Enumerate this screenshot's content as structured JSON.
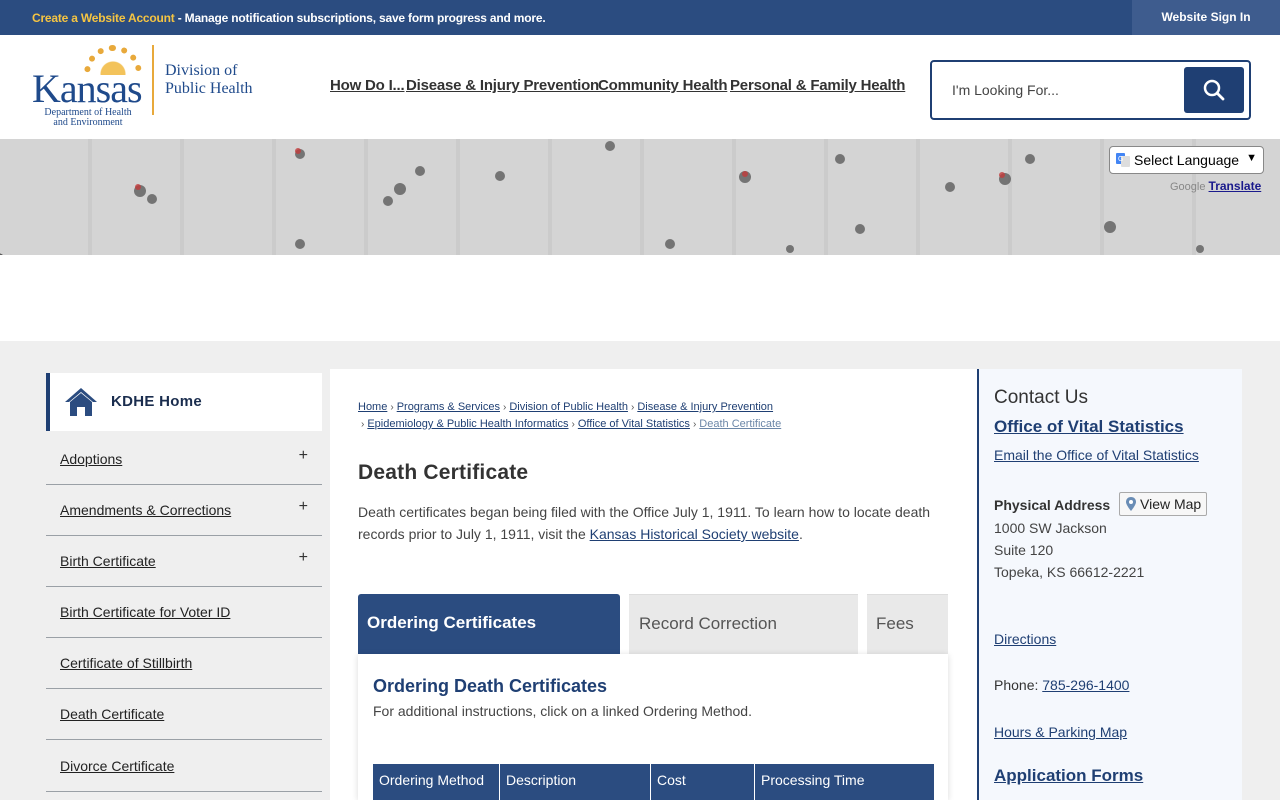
{
  "topbar": {
    "promo_link": "Create a Website Account",
    "promo_text": " - Manage notification subscriptions, save form progress and more.",
    "sign_in": "Website Sign In"
  },
  "logo": {
    "brand": "Kansas",
    "dept_line1": "Department of Health",
    "dept_line2": "and Environment",
    "division_line1": "Division of",
    "division_line2": "Public Health"
  },
  "nav": {
    "items": [
      "How Do I...",
      "Disease & Injury Prevention",
      "Community Health",
      "Personal & Family Health"
    ]
  },
  "search": {
    "placeholder": "I'm Looking For..."
  },
  "translate": {
    "select_label": "Select Language",
    "powered_by": "Google",
    "translate_label": "Translate"
  },
  "sidebar": {
    "home_label": "KDHE Home",
    "items": [
      {
        "label": "Adoptions",
        "expand": "+"
      },
      {
        "label": "Amendments & Corrections",
        "expand": "+"
      },
      {
        "label": "Birth Certificate",
        "expand": "+"
      },
      {
        "label": "Birth Certificate for Voter ID",
        "expand": ""
      },
      {
        "label": "Certificate of Stillbirth",
        "expand": ""
      },
      {
        "label": "Death Certificate",
        "expand": ""
      },
      {
        "label": "Divorce Certificate",
        "expand": ""
      }
    ]
  },
  "breadcrumb": {
    "items": [
      "Home",
      "Programs & Services",
      "Division of Public Health",
      "Disease & Injury Prevention",
      "Epidemiology & Public Health Informatics",
      "Office of Vital Statistics"
    ],
    "current": "Death Certificate"
  },
  "page": {
    "title": "Death Certificate",
    "intro_text": "Death certificates began being filed with the Office July 1, 1911. To learn how to locate death records prior to July 1, 1911, visit the ",
    "intro_link": "Kansas Historical Society website",
    "intro_end": "."
  },
  "tabs": [
    "Ordering Certificates",
    "Record Correction",
    "Fees"
  ],
  "panel": {
    "heading": "Ordering Death Certificates",
    "subtext": "For additional instructions, click on a linked Ordering Method.",
    "columns": [
      "Ordering Method",
      "Description",
      "Cost",
      "Processing Time"
    ]
  },
  "contact": {
    "heading": "Contact Us",
    "office": "Office of Vital Statistics",
    "email_link": "Email the Office of Vital Statistics",
    "address_label": "Physical Address",
    "view_map": "View Map",
    "address_line1": "1000 SW Jackson",
    "address_line2": "Suite 120",
    "address_line3": "Topeka, KS 66612-2221",
    "directions": "Directions",
    "phone_label": "Phone: ",
    "phone": "785-296-1400",
    "hours_link": "Hours & Parking Map",
    "forms_heading": "Application Forms"
  },
  "colors": {
    "primary": "#2b4c80",
    "accent": "#f5c442"
  }
}
